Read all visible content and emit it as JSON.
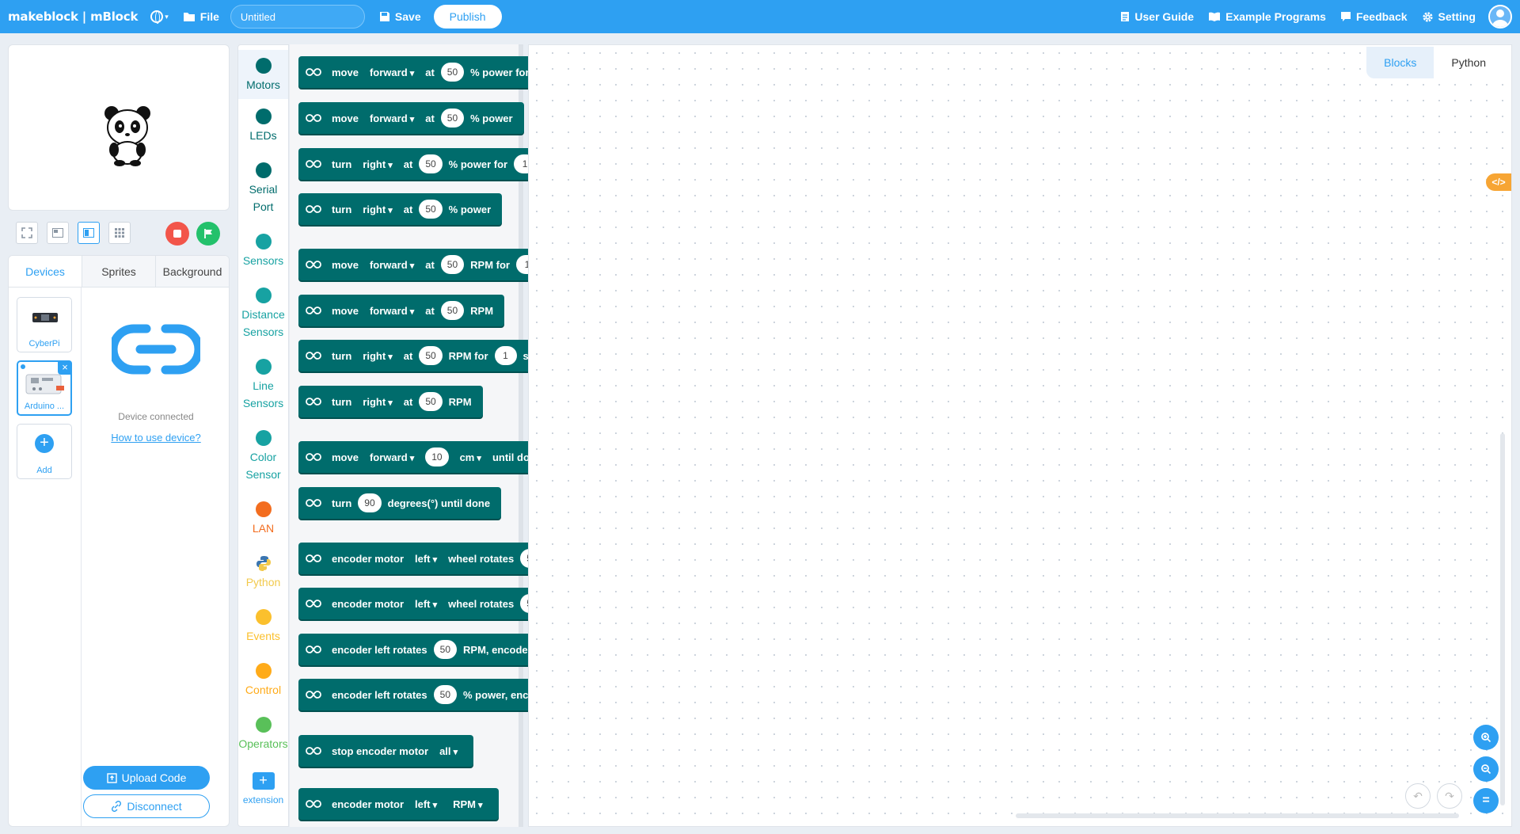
{
  "topbar": {
    "logo": "makeblock | mBlock",
    "file_label": "File",
    "title_value": "Untitled",
    "save_label": "Save",
    "publish_label": "Publish",
    "user_guide_label": "User Guide",
    "example_programs_label": "Example Programs",
    "feedback_label": "Feedback",
    "setting_label": "Setting",
    "bar_color": "#2ea0f2"
  },
  "device_panel": {
    "tabs": [
      "Devices",
      "Sprites",
      "Background"
    ],
    "active_tab": "Devices",
    "devices": [
      {
        "name": "CyberPi"
      },
      {
        "name": "Arduino ..."
      }
    ],
    "add_label": "Add",
    "status": "Device connected",
    "help_link": "How to use device?",
    "upload_label": "Upload Code",
    "disconnect_label": "Disconnect"
  },
  "categories": [
    {
      "label": "Motors",
      "color": "#006c6c"
    },
    {
      "label": "LEDs",
      "color": "#006c6c"
    },
    {
      "label": "Serial Port",
      "color": "#006c6c"
    },
    {
      "label": "Sensors",
      "color": "#17a2a2"
    },
    {
      "label": "Distance Sensors",
      "color": "#17a2a2"
    },
    {
      "label": "Line Sensors",
      "color": "#17a2a2"
    },
    {
      "label": "Color Sensor",
      "color": "#17a2a2"
    },
    {
      "label": "LAN",
      "color": "#f36d1f"
    },
    {
      "label": "Python",
      "color": "#f2c94c"
    },
    {
      "label": "Events",
      "color": "#fbc02d"
    },
    {
      "label": "Control",
      "color": "#ffab19"
    },
    {
      "label": "Operators",
      "color": "#59c059"
    }
  ],
  "extension_label": "extension",
  "blocks": [
    [
      {
        "t": "s",
        "v": "move"
      },
      {
        "t": "d",
        "v": "forward"
      },
      {
        "t": "s",
        "v": "at"
      },
      {
        "t": "n",
        "v": "50"
      },
      {
        "t": "s",
        "v": "% power for"
      },
      {
        "t": "n",
        "v": "1"
      },
      {
        "t": "s",
        "v": "seconds"
      }
    ],
    [
      {
        "t": "s",
        "v": "move"
      },
      {
        "t": "d",
        "v": "forward"
      },
      {
        "t": "s",
        "v": "at"
      },
      {
        "t": "n",
        "v": "50"
      },
      {
        "t": "s",
        "v": "% power"
      }
    ],
    [
      {
        "t": "s",
        "v": "turn"
      },
      {
        "t": "d",
        "v": "right"
      },
      {
        "t": "s",
        "v": "at"
      },
      {
        "t": "n",
        "v": "50"
      },
      {
        "t": "s",
        "v": "% power for"
      },
      {
        "t": "n",
        "v": "1"
      },
      {
        "t": "s",
        "v": "seconds"
      }
    ],
    [
      {
        "t": "s",
        "v": "turn"
      },
      {
        "t": "d",
        "v": "right"
      },
      {
        "t": "s",
        "v": "at"
      },
      {
        "t": "n",
        "v": "50"
      },
      {
        "t": "s",
        "v": "% power"
      }
    ],
    [
      {
        "t": "s",
        "v": "move"
      },
      {
        "t": "d",
        "v": "forward"
      },
      {
        "t": "s",
        "v": "at"
      },
      {
        "t": "n",
        "v": "50"
      },
      {
        "t": "s",
        "v": "RPM for"
      },
      {
        "t": "n",
        "v": "1"
      },
      {
        "t": "s",
        "v": "seconds"
      }
    ],
    [
      {
        "t": "s",
        "v": "move"
      },
      {
        "t": "d",
        "v": "forward"
      },
      {
        "t": "s",
        "v": "at"
      },
      {
        "t": "n",
        "v": "50"
      },
      {
        "t": "s",
        "v": "RPM"
      }
    ],
    [
      {
        "t": "s",
        "v": "turn"
      },
      {
        "t": "d",
        "v": "right"
      },
      {
        "t": "s",
        "v": "at"
      },
      {
        "t": "n",
        "v": "50"
      },
      {
        "t": "s",
        "v": "RPM for"
      },
      {
        "t": "n",
        "v": "1"
      },
      {
        "t": "s",
        "v": "seconds"
      }
    ],
    [
      {
        "t": "s",
        "v": "turn"
      },
      {
        "t": "d",
        "v": "right"
      },
      {
        "t": "s",
        "v": "at"
      },
      {
        "t": "n",
        "v": "50"
      },
      {
        "t": "s",
        "v": "RPM"
      }
    ],
    [
      {
        "t": "s",
        "v": "move"
      },
      {
        "t": "d",
        "v": "forward"
      },
      {
        "t": "n",
        "v": "10"
      },
      {
        "t": "d",
        "v": "cm"
      },
      {
        "t": "s",
        "v": "until done"
      }
    ],
    [
      {
        "t": "s",
        "v": "turn"
      },
      {
        "t": "n",
        "v": "90"
      },
      {
        "t": "s",
        "v": "degrees(°) until done"
      }
    ],
    [
      {
        "t": "s",
        "v": "encoder motor"
      },
      {
        "t": "d",
        "v": "left"
      },
      {
        "t": "s",
        "v": "wheel rotates"
      },
      {
        "t": "n",
        "v": "50"
      },
      {
        "t": "d",
        "v": "RPM"
      },
      {
        "t": "s",
        "v": "for"
      },
      {
        "t": "n",
        "v": "1"
      },
      {
        "t": "s",
        "v": "seconds"
      }
    ],
    [
      {
        "t": "s",
        "v": "encoder motor"
      },
      {
        "t": "d",
        "v": "left"
      },
      {
        "t": "s",
        "v": "wheel rotates"
      },
      {
        "t": "n",
        "v": "50"
      },
      {
        "t": "d",
        "v": "RPM"
      }
    ],
    [
      {
        "t": "s",
        "v": "encoder left rotates"
      },
      {
        "t": "n",
        "v": "50"
      },
      {
        "t": "s",
        "v": "RPM, encoder right rotates"
      },
      {
        "t": "n",
        "v": "50"
      },
      {
        "t": "s",
        "v": "RPM"
      }
    ],
    [
      {
        "t": "s",
        "v": "encoder left rotates"
      },
      {
        "t": "n",
        "v": "50"
      },
      {
        "t": "s",
        "v": "% power, encoder right rotates"
      },
      {
        "t": "n",
        "v": "50"
      },
      {
        "t": "s",
        "v": "% power"
      }
    ],
    [
      {
        "t": "s",
        "v": "stop encoder motor"
      },
      {
        "t": "d",
        "v": "all"
      }
    ],
    [
      {
        "t": "s",
        "v": "encoder motor"
      },
      {
        "t": "d",
        "v": "left"
      },
      {
        "t": "d",
        "v": "RPM"
      }
    ]
  ],
  "workspace": {
    "tabs": [
      "Blocks",
      "Python"
    ],
    "active_tab": "Blocks",
    "code_toggle": "</>"
  }
}
